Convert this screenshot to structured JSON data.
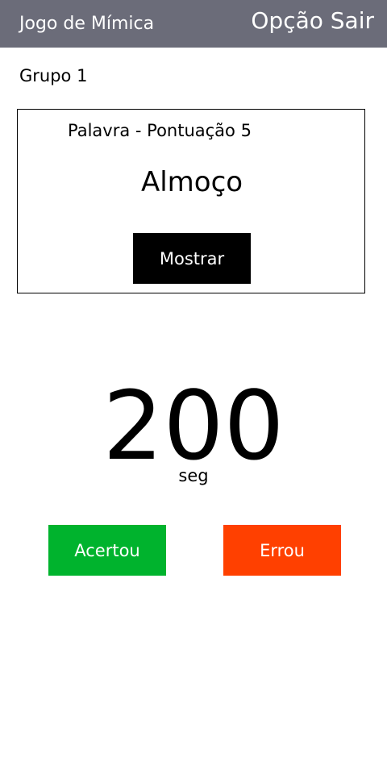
{
  "header": {
    "title": "Jogo de Mímica",
    "exit_label": "Opção Sair"
  },
  "group": {
    "label": "Grupo 1"
  },
  "word_card": {
    "meta": "Palavra - Pontuação 5",
    "word": "Almoço",
    "show_button": "Mostrar"
  },
  "timer": {
    "value": "200",
    "unit": "seg"
  },
  "actions": {
    "correct": "Acertou",
    "wrong": "Errou"
  },
  "colors": {
    "header_bg": "#6b6c79",
    "correct_bg": "#00b32d",
    "wrong_bg": "#ff4000",
    "show_button_bg": "#000000"
  }
}
